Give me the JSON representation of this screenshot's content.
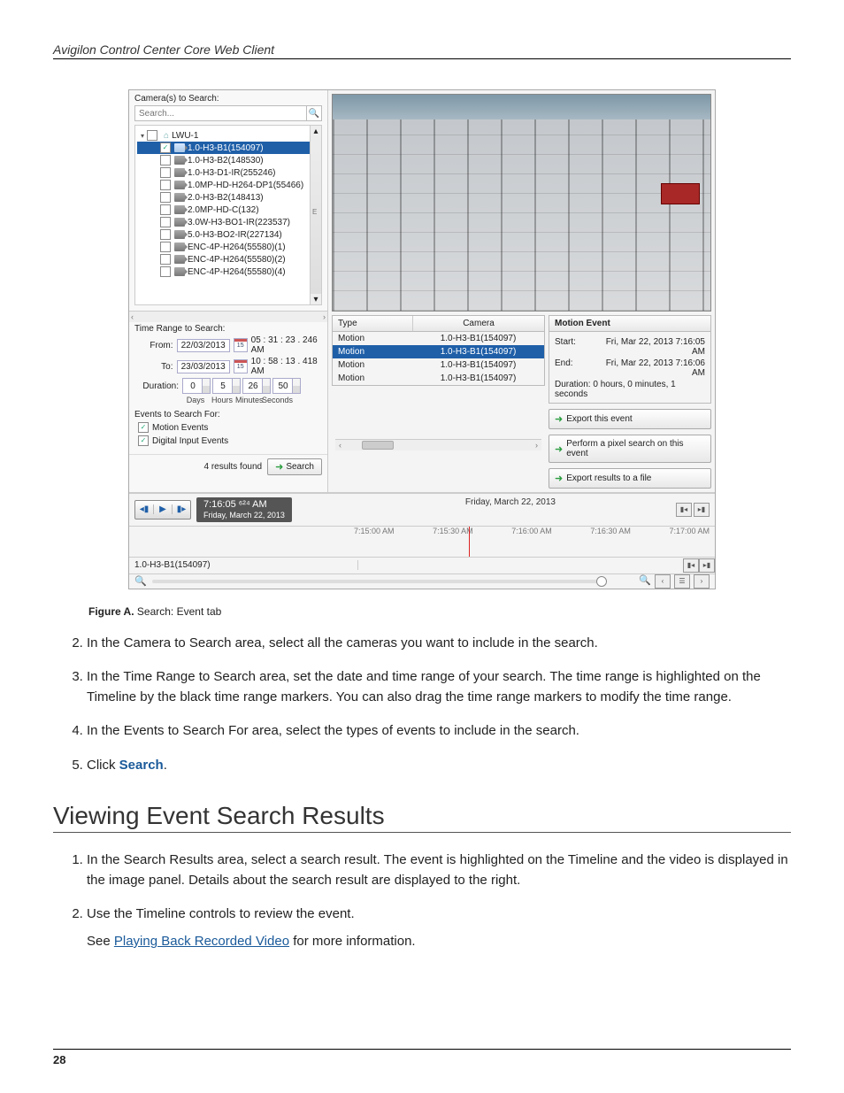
{
  "header_title": "Avigilon Control Center Core Web Client",
  "page_number": "28",
  "figure": {
    "caption_label": "Figure A.",
    "caption_text": "Search: Event tab"
  },
  "screenshot": {
    "left": {
      "cameras_label": "Camera(s) to Search:",
      "search_placeholder": "Search...",
      "site": "LWU-1",
      "cameras": [
        "1.0-H3-B1(154097)",
        "1.0-H3-B2(148530)",
        "1.0-H3-D1-IR(255246)",
        "1.0MP-HD-H264-DP1(55466)",
        "2.0-H3-B2(148413)",
        "2.0MP-HD-C(132)",
        "3.0W-H3-BO1-IR(223537)",
        "5.0-H3-BO2-IR(227134)",
        "ENC-4P-H264(55580)(1)",
        "ENC-4P-H264(55580)(2)",
        "ENC-4P-H264(55580)(4)"
      ],
      "time_label": "Time Range to Search:",
      "from_label": "From:",
      "from_date": "22/03/2013",
      "from_cal": "15",
      "from_time": "05 : 31 : 23 . 246  AM",
      "to_label": "To:",
      "to_date": "23/03/2013",
      "to_cal": "15",
      "to_time": "10 : 58 : 13 . 418  AM",
      "duration_label": "Duration:",
      "duration": {
        "days": "0",
        "hours": "5",
        "minutes": "26",
        "seconds": "50"
      },
      "dur_units": [
        "Days",
        "Hours",
        "Minutes",
        "Seconds"
      ],
      "events_label": "Events to Search For:",
      "ev_motion": "Motion Events",
      "ev_digital": "Digital Input Events",
      "results_found": "4 results found",
      "search_btn": "Search"
    },
    "results": {
      "col_type": "Type",
      "col_camera": "Camera",
      "rows": [
        {
          "type": "Motion",
          "camera": "1.0-H3-B1(154097)"
        },
        {
          "type": "Motion",
          "camera": "1.0-H3-B1(154097)"
        },
        {
          "type": "Motion",
          "camera": "1.0-H3-B1(154097)"
        },
        {
          "type": "Motion",
          "camera": "1.0-H3-B1(154097)"
        }
      ]
    },
    "detail": {
      "title": "Motion Event",
      "start_k": "Start:",
      "start_v": "Fri, Mar 22, 2013 7:16:05 AM",
      "end_k": "End:",
      "end_v": "Fri, Mar 22, 2013 7:16:06 AM",
      "duration": "Duration: 0 hours, 0 minutes, 1 seconds",
      "act_export_event": "Export this event",
      "act_pixel_search": "Perform a pixel search on this event",
      "act_export_file": "Export results to a file"
    },
    "timeline": {
      "play_time": "7:16:05 ⁶²⁴ AM",
      "play_date": "Friday, March 22, 2013",
      "date_label": "Friday, March 22, 2013",
      "ticks": [
        "7:15:00 AM",
        "7:15:30 AM",
        "7:16:00 AM",
        "7:16:30 AM",
        "7:17:00 AM"
      ],
      "camera_name": "1.0-H3-B1(154097)"
    }
  },
  "steps_upper": [
    "In the Camera to Search area, select all the cameras you want to include in the search.",
    "In the Time Range to Search area, set the date and time range of your search. The time range is highlighted on the Timeline by the black time range markers. You can also drag the time range markers to modify the time range.",
    "In the Events to Search For area, select the types of events to include in the search."
  ],
  "step5_prefix": "Click ",
  "step5_term": "Search",
  "step5_suffix": ".",
  "section_title": "Viewing Event Search Results",
  "steps_lower": {
    "step1": "In the Search Results area, select a search result. The event is highlighted on the Timeline and the video is displayed in the image panel. Details about the search result are displayed to the right.",
    "step2": "Use the Timeline controls to review the event.",
    "step2_sub_prefix": "See ",
    "step2_link": "Playing Back Recorded Video",
    "step2_sub_suffix": " for more information."
  }
}
